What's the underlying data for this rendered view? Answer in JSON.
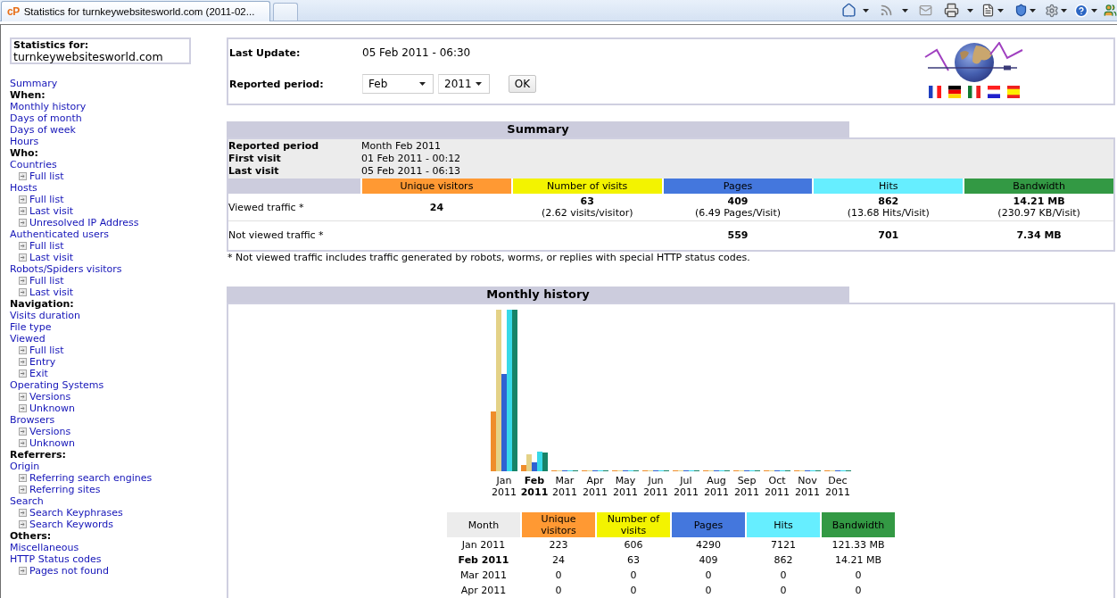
{
  "browser": {
    "tab": {
      "favicon_text": "cP",
      "title": "Statistics for turnkeywebsitesworld.com (2011-02..."
    }
  },
  "sidebar": {
    "header": {
      "label": "Statistics for:",
      "site": "turnkeywebsitesworld.com"
    },
    "items": [
      {
        "kind": "link",
        "label": "Summary"
      },
      {
        "kind": "heading",
        "label": "When:"
      },
      {
        "kind": "link",
        "label": "Monthly history"
      },
      {
        "kind": "link",
        "label": "Days of month"
      },
      {
        "kind": "link",
        "label": "Days of week"
      },
      {
        "kind": "link",
        "label": "Hours"
      },
      {
        "kind": "heading",
        "label": "Who:"
      },
      {
        "kind": "link",
        "label": "Countries",
        "children": [
          {
            "label": "Full list"
          }
        ]
      },
      {
        "kind": "link",
        "label": "Hosts",
        "children": [
          {
            "label": "Full list"
          },
          {
            "label": "Last visit"
          },
          {
            "label": "Unresolved IP Address"
          }
        ]
      },
      {
        "kind": "link",
        "label": "Authenticated users",
        "children": [
          {
            "label": "Full list"
          },
          {
            "label": "Last visit"
          }
        ]
      },
      {
        "kind": "link",
        "label": "Robots/Spiders visitors",
        "children": [
          {
            "label": "Full list"
          },
          {
            "label": "Last visit"
          }
        ]
      },
      {
        "kind": "heading",
        "label": "Navigation:"
      },
      {
        "kind": "link",
        "label": "Visits duration"
      },
      {
        "kind": "link",
        "label": "File type"
      },
      {
        "kind": "link",
        "label": "Viewed",
        "children": [
          {
            "label": "Full list"
          },
          {
            "label": "Entry"
          },
          {
            "label": "Exit"
          }
        ]
      },
      {
        "kind": "link",
        "label": "Operating Systems",
        "children": [
          {
            "label": "Versions"
          },
          {
            "label": "Unknown"
          }
        ]
      },
      {
        "kind": "link",
        "label": "Browsers",
        "children": [
          {
            "label": "Versions"
          },
          {
            "label": "Unknown"
          }
        ]
      },
      {
        "kind": "heading",
        "label": "Referrers:"
      },
      {
        "kind": "link",
        "label": "Origin",
        "children": [
          {
            "label": "Referring search engines"
          },
          {
            "label": "Referring sites"
          }
        ]
      },
      {
        "kind": "link",
        "label": "Search",
        "children": [
          {
            "label": "Search Keyphrases"
          },
          {
            "label": "Search Keywords"
          }
        ]
      },
      {
        "kind": "heading",
        "label": "Others:"
      },
      {
        "kind": "link",
        "label": "Miscellaneous"
      },
      {
        "kind": "link",
        "label": "HTTP Status codes",
        "children": [
          {
            "label": "Pages not found"
          }
        ]
      }
    ]
  },
  "update_panel": {
    "last_update": {
      "label": "Last Update:",
      "value": "05 Feb 2011 - 06:30"
    },
    "reported_period": {
      "label": "Reported period:",
      "month": "Feb",
      "year": "2011",
      "button": "OK"
    }
  },
  "summary": {
    "title": "Summary",
    "info": [
      {
        "label": "Reported period",
        "value": "Month Feb 2011"
      },
      {
        "label": "First visit",
        "value": "01 Feb 2011 - 00:12"
      },
      {
        "label": "Last visit",
        "value": "05 Feb 2011 - 06:13"
      }
    ],
    "columns": [
      {
        "label": "Unique visitors",
        "color": "#ff9933"
      },
      {
        "label": "Number of visits",
        "color": "#f3f300"
      },
      {
        "label": "Pages",
        "color": "#4477dd"
      },
      {
        "label": "Hits",
        "color": "#66eeff"
      },
      {
        "label": "Bandwidth",
        "color": "#339944"
      }
    ],
    "rows": [
      {
        "label": "Viewed traffic *",
        "cells": [
          {
            "value": "24"
          },
          {
            "value": "63",
            "detail": "(2.62 visits/visitor)"
          },
          {
            "value": "409",
            "detail": "(6.49 Pages/Visit)"
          },
          {
            "value": "862",
            "detail": "(13.68 Hits/Visit)"
          },
          {
            "value": "14.21 MB",
            "detail": "(230.97 KB/Visit)"
          }
        ]
      },
      {
        "label": "Not viewed traffic *",
        "cells": [
          {},
          {},
          {
            "value": "559"
          },
          {
            "value": "701"
          },
          {
            "value": "7.34 MB"
          }
        ]
      }
    ],
    "footnote": "* Not viewed traffic includes traffic generated by robots, worms, or replies with special HTTP status codes."
  },
  "monthly_history": {
    "title": "Monthly history",
    "chart_labels": [
      "Jan 2011",
      "Feb 2011",
      "Mar 2011",
      "Apr 2011",
      "May 2011",
      "Jun 2011",
      "Jul 2011",
      "Aug 2011",
      "Sep 2011",
      "Oct 2011",
      "Nov 2011",
      "Dec 2011"
    ],
    "table": {
      "columns": [
        {
          "label": "Month"
        },
        {
          "label": "Unique visitors",
          "color": "#ff9933"
        },
        {
          "label": "Number of visits",
          "color": "#f3f300"
        },
        {
          "label": "Pages",
          "color": "#4477dd"
        },
        {
          "label": "Hits",
          "color": "#66eeff"
        },
        {
          "label": "Bandwidth",
          "color": "#339944"
        }
      ],
      "rows": [
        {
          "selected": false,
          "cells": [
            "Jan 2011",
            "223",
            "606",
            "4290",
            "7121",
            "121.33 MB"
          ]
        },
        {
          "selected": true,
          "cells": [
            "Feb 2011",
            "24",
            "63",
            "409",
            "862",
            "14.21 MB"
          ]
        },
        {
          "selected": false,
          "cells": [
            "Mar 2011",
            "0",
            "0",
            "0",
            "0",
            "0"
          ]
        },
        {
          "selected": false,
          "cells": [
            "Apr 2011",
            "0",
            "0",
            "0",
            "0",
            "0"
          ]
        }
      ]
    }
  }
}
